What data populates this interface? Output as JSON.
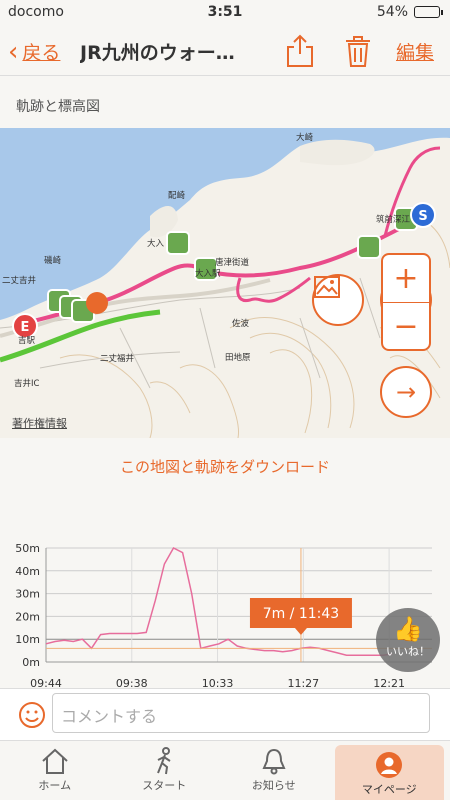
{
  "status": {
    "carrier": "docomo",
    "time": "3:51",
    "battery": "54%",
    "battery_level": 0.54
  },
  "nav": {
    "back_label": "戻る",
    "title": "JR九州のウォー…",
    "edit_label": "編集"
  },
  "section_title": "軌跡と標高図",
  "map": {
    "copyright_label": "著作権情報",
    "start_marker": "S",
    "end_marker": "E",
    "labels": [
      "大入",
      "大入駅",
      "唐津街道",
      "佐波",
      "田地原",
      "二丈福井",
      "吉井IC",
      "配崎",
      "大崎",
      "筑前深江",
      "二丈吉井",
      "吉駅",
      "磯崎"
    ],
    "route_color": "#e94b8a",
    "road_color": "#5cc639"
  },
  "download_label": "この地図と軌跡をダウンロード",
  "chart_data": {
    "type": "line",
    "y_ticks": [
      "50m",
      "40m",
      "30m",
      "20m",
      "10m",
      "0m"
    ],
    "x_ticks": [
      "09:44",
      "09:38",
      "10:33",
      "11:27",
      "12:21"
    ],
    "ylim": [
      0,
      50
    ],
    "series": [
      {
        "color": "#e76d9c",
        "values": [
          8,
          9,
          9.5,
          9,
          10,
          6,
          12,
          12.5,
          12.5,
          12.5,
          12.5,
          13,
          27,
          43,
          50,
          48,
          30,
          6,
          7,
          8,
          10,
          7,
          6,
          5.5,
          5,
          5,
          4.5,
          5,
          6,
          6.5,
          6,
          5,
          4,
          3,
          3,
          3,
          3,
          3,
          3.5
        ]
      }
    ],
    "tooltip": "7m / 11:43",
    "cursor_index": 28,
    "accent": "#e8692c"
  },
  "like_label": "いいね！",
  "comment_placeholder": "コメントする",
  "tabs": [
    {
      "label": "ホーム",
      "icon": "home-icon"
    },
    {
      "label": "スタート",
      "icon": "walk-icon"
    },
    {
      "label": "お知らせ",
      "icon": "bell-icon"
    },
    {
      "label": "マイページ",
      "icon": "person-icon"
    }
  ]
}
